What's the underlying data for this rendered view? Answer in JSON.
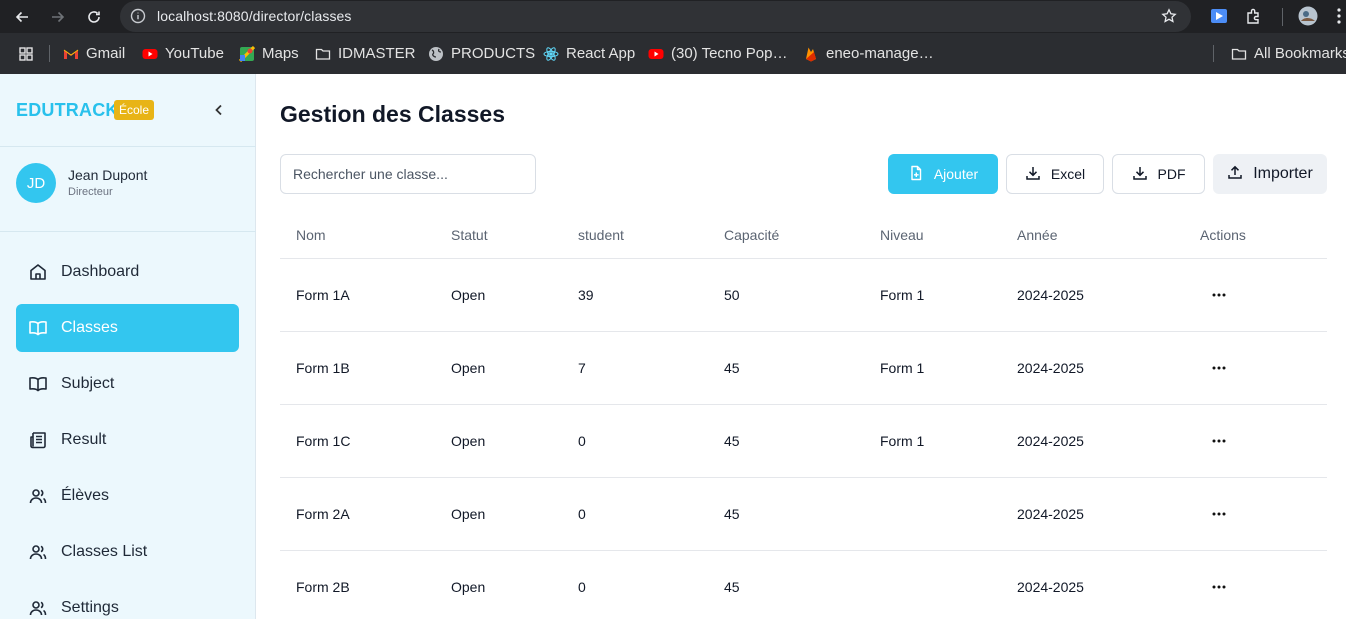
{
  "browser": {
    "url": "localhost:8080/director/classes",
    "bookmarks": [
      {
        "label": "Gmail",
        "icon": "gmail-icon"
      },
      {
        "label": "YouTube",
        "icon": "youtube-icon"
      },
      {
        "label": "Maps",
        "icon": "maps-icon"
      },
      {
        "label": "IDMASTER",
        "icon": "folder-icon"
      },
      {
        "label": "PRODUCTS",
        "icon": "globe-icon"
      },
      {
        "label": "React App",
        "icon": "react-icon"
      },
      {
        "label": "(30) Tecno Pop…",
        "icon": "youtube-icon"
      },
      {
        "label": "eneo-manage…",
        "icon": "firebase-icon"
      }
    ],
    "all_bookmarks": "All Bookmarks"
  },
  "sidebar": {
    "brand": "EDUTRACK",
    "badge": "École",
    "user": {
      "initials": "JD",
      "name": "Jean Dupont",
      "role": "Directeur"
    },
    "items": [
      {
        "label": "Dashboard",
        "icon": "home-icon",
        "active": false
      },
      {
        "label": "Classes",
        "icon": "book-open-icon",
        "active": true
      },
      {
        "label": "Subject",
        "icon": "book-open-icon",
        "active": false
      },
      {
        "label": "Result",
        "icon": "newspaper-icon",
        "active": false
      },
      {
        "label": "Élèves",
        "icon": "users-icon",
        "active": false
      },
      {
        "label": "Classes List",
        "icon": "users-icon",
        "active": false
      },
      {
        "label": "Settings",
        "icon": "users-icon",
        "active": false
      }
    ]
  },
  "main": {
    "title": "Gestion des Classes",
    "search_placeholder": "Rechercher une classe...",
    "buttons": {
      "add": "Ajouter",
      "excel": "Excel",
      "pdf": "PDF",
      "import": "Importer"
    },
    "table": {
      "headers": [
        "Nom",
        "Statut",
        "student",
        "Capacité",
        "Niveau",
        "Année",
        "Actions"
      ],
      "rows": [
        [
          "Form 1A",
          "Open",
          "39",
          "50",
          "Form 1",
          "2024-2025"
        ],
        [
          "Form 1B",
          "Open",
          "7",
          "45",
          "Form 1",
          "2024-2025"
        ],
        [
          "Form 1C",
          "Open",
          "0",
          "45",
          "Form 1",
          "2024-2025"
        ],
        [
          "Form 2A",
          "Open",
          "0",
          "45",
          "",
          "2024-2025"
        ],
        [
          "Form 2B",
          "Open",
          "0",
          "45",
          "",
          "2024-2025"
        ]
      ]
    }
  }
}
